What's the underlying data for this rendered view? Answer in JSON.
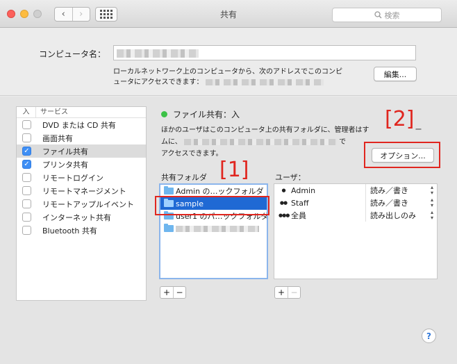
{
  "window": {
    "title": "共有",
    "search_placeholder": "検索",
    "icons": {
      "back": "chevron-left-icon",
      "forward": "chevron-right-icon",
      "grid": "grid-icon",
      "search": "magnifier-icon"
    }
  },
  "computer_name": {
    "label": "コンピュータ名：",
    "description_line1": "ローカルネットワーク上のコンピュータから、次のアドレスでこのコンピ",
    "description_line2": "ュータにアクセスできます：",
    "edit_button": "編集..."
  },
  "services": {
    "header_on": "入",
    "header_service": "サービス",
    "items": [
      {
        "label": "DVD または CD 共有",
        "checked": false,
        "selected": false
      },
      {
        "label": "画面共有",
        "checked": false,
        "selected": false
      },
      {
        "label": "ファイル共有",
        "checked": true,
        "selected": true
      },
      {
        "label": "プリンタ共有",
        "checked": true,
        "selected": false
      },
      {
        "label": "リモートログイン",
        "checked": false,
        "selected": false
      },
      {
        "label": "リモートマネージメント",
        "checked": false,
        "selected": false
      },
      {
        "label": "リモートアップルイベント",
        "checked": false,
        "selected": false
      },
      {
        "label": "インターネット共有",
        "checked": false,
        "selected": false
      },
      {
        "label": "Bluetooth 共有",
        "checked": false,
        "selected": false
      }
    ]
  },
  "detail": {
    "status": "ファイル共有：入",
    "status_color": "#3cc247",
    "desc_line1": "ほかのユーザはこのコンピュータ上の共有フォルダに、管理者はす",
    "desc_line1_tail": "ー",
    "desc_line2_head": "ムに、",
    "desc_line2_tail": "で",
    "desc_line3": "アクセスできます。",
    "options_button": "オプション...",
    "shared_folders_label": "共有フォルダ",
    "users_label": "ユーザ：",
    "folders": [
      {
        "name": "Admin の…ックフォルダ",
        "selected": false
      },
      {
        "name": "sample",
        "selected": true
      },
      {
        "name": "user1 のパ…ックフォルダ",
        "selected": false
      }
    ],
    "users": [
      {
        "name": "Admin",
        "permission": "読み／書き",
        "icon": "person-icon"
      },
      {
        "name": "Staff",
        "permission": "読み／書き",
        "icon": "group-icon"
      },
      {
        "name": "全員",
        "permission": "読み出しのみ",
        "icon": "everyone-icon"
      }
    ],
    "plus": "+",
    "minus": "−"
  },
  "annotations": {
    "label1": "[1]",
    "label2": "[2]",
    "color": "#e0261f"
  },
  "help": "?"
}
